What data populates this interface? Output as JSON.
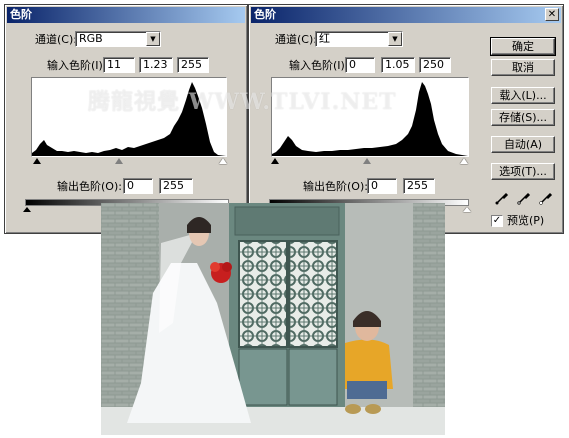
{
  "left_dialog": {
    "title": "色阶",
    "channel_label": "通道(C):",
    "channel_value": "RGB",
    "input_levels_label": "输入色阶(I):",
    "input_levels": [
      "11",
      "1.23",
      "255"
    ],
    "output_levels_label": "输出色阶(O):",
    "output_levels": [
      "0",
      "255"
    ]
  },
  "right_dialog": {
    "title": "色阶",
    "close_glyph": "✕",
    "channel_label": "通道(C):",
    "channel_value": "红",
    "input_levels_label": "输入色阶(I):",
    "input_levels": [
      "0",
      "1.05",
      "250"
    ],
    "output_levels_label": "输出色阶(O):",
    "output_levels": [
      "0",
      "255"
    ],
    "buttons": {
      "ok": "确定",
      "cancel": "取消",
      "load": "载入(L)...",
      "save": "存储(S)...",
      "auto": "自动(A)",
      "options": "选项(T)..."
    },
    "preview_label": "预览(P)",
    "preview_checked": true
  },
  "watermark": "腾龍視覺 WWW.TLVI.NET",
  "icons": {
    "eyedroppers": [
      "black-eyedropper-icon",
      "gray-eyedropper-icon",
      "white-eyedropper-icon"
    ]
  }
}
